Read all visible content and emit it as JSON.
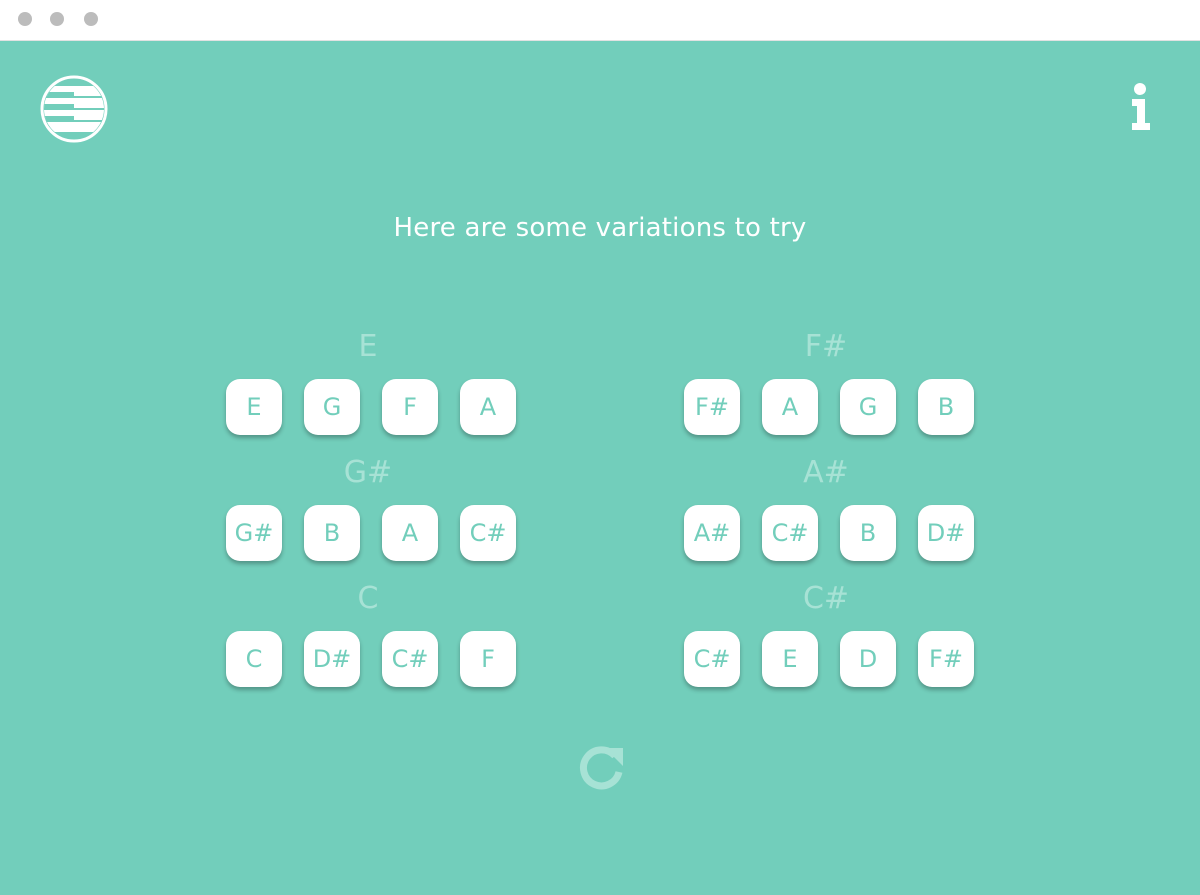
{
  "headline": "Here are some variations to try",
  "colors": {
    "background": "#72cebb",
    "key_bg": "#ffffff",
    "key_text": "#72cebb",
    "root_label": "#a7e2d5"
  },
  "icons": {
    "logo": "piano-logo-icon",
    "info": "info-icon",
    "refresh": "refresh-icon"
  },
  "columns": [
    {
      "groups": [
        {
          "root": "E",
          "notes": [
            "E",
            "G",
            "F",
            "A"
          ]
        },
        {
          "root": "G#",
          "notes": [
            "G#",
            "B",
            "A",
            "C#"
          ]
        },
        {
          "root": "C",
          "notes": [
            "C",
            "D#",
            "C#",
            "F"
          ]
        }
      ]
    },
    {
      "groups": [
        {
          "root": "F#",
          "notes": [
            "F#",
            "A",
            "G",
            "B"
          ]
        },
        {
          "root": "A#",
          "notes": [
            "A#",
            "C#",
            "B",
            "D#"
          ]
        },
        {
          "root": "C#",
          "notes": [
            "C#",
            "E",
            "D",
            "F#"
          ]
        }
      ]
    }
  ]
}
